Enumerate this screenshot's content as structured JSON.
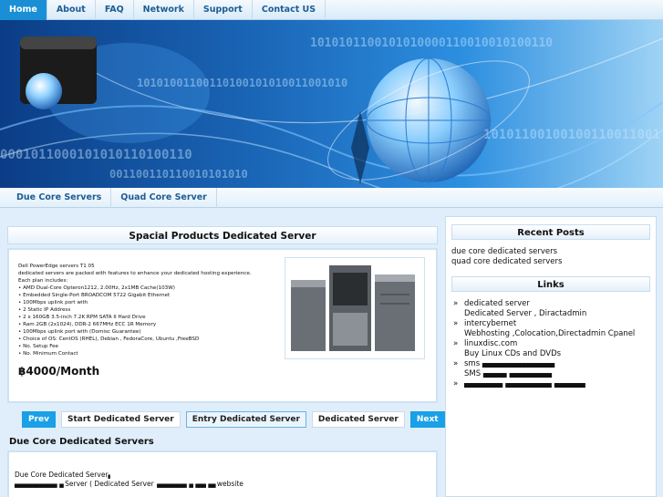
{
  "nav": {
    "items": [
      "Home",
      "About",
      "FAQ",
      "Network",
      "Support",
      "Contact US"
    ],
    "active": "Home"
  },
  "banner": {
    "binary": [
      "1010101100101010000110010010100110",
      "10101001100110100101010011001010",
      "10101100100100110011001",
      "0001011000101010110100110",
      "001100110110010101010"
    ]
  },
  "subnav": {
    "items": [
      "Due Core Servers",
      "Quad Core Server"
    ]
  },
  "product": {
    "title": "Spacial Products Dedicated Server",
    "lines": [
      "Dell PowerEdge servers T1 05",
      "dedicated servers are packed with features to enhance your dedicated hosting experience.",
      "Each plan includes:",
      "• AMD Dual-Core Opteron1212, 2.00Hz, 2x1MB Cache(103W)",
      "• Embedded Single-Port BROADCOM 5722 Gigabit Ethernet",
      "• 100Mbps uplink port with",
      "• 2 Static IP Address",
      "• 2 x 160GB 3.5-inch 7.2K RPM SATA II Hard Drive",
      "• Ram 2GB (2x1024), DDR-2 667MHz ECC 1R Memory",
      "• 100Mbps uplink port with (Domisc Guarantee)",
      "• Choice of OS: CentOS (RHEL), Debian , FedoraCore, Ubuntu ,FreeBSD",
      "• No. Setup Fee",
      "• No. Minimum Contact"
    ],
    "price": "฿4000/Month"
  },
  "buttons": {
    "prev": "Prev",
    "a": "Start Dedicated Server",
    "b": "Entry Dedicated Server",
    "c": "Dedicated Server",
    "next": "Next"
  },
  "second": {
    "title": "Due Core Dedicated Servers",
    "line1": "Due Core Dedicated Server",
    "line2a": "Server ( Dedicated Server",
    "line2b": "website"
  },
  "sidebar": {
    "recent_title": "Recent Posts",
    "recent": [
      "due core dedicated servers",
      "quad core dedicated servers"
    ],
    "links_title": "Links",
    "links": [
      {
        "label": "dedicated server",
        "sub": "Dedicated Server , Diractadmin"
      },
      {
        "label": "intercybernet",
        "sub": "Webhosting ,Colocation,Directadmin Cpanel"
      },
      {
        "label": "linuxdisc.com",
        "sub": "Buy Linux CDs and DVDs"
      },
      {
        "label": "sms",
        "sub": "SMS"
      }
    ]
  },
  "colors": {
    "accent": "#1a8fd6",
    "banner_dark": "#0b3d86"
  }
}
